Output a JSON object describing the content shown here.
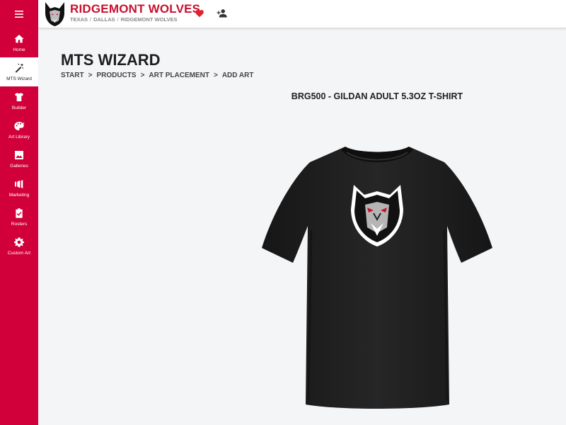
{
  "header": {
    "team_name": "RIDGEMONT WOLVES",
    "breadcrumb": [
      "TEXAS",
      "DALLAS",
      "RIDGEMONT WOLVES"
    ],
    "breadcrumb_separator": "/"
  },
  "sidebar": {
    "items": [
      {
        "label": "Home",
        "icon": "home-icon"
      },
      {
        "label": "MTS Wizard",
        "icon": "magic-wand-icon",
        "active": true
      },
      {
        "label": "Builder",
        "icon": "tshirt-icon"
      },
      {
        "label": "Art Library",
        "icon": "palette-icon"
      },
      {
        "label": "Galleries",
        "icon": "image-icon"
      },
      {
        "label": "Marketing",
        "icon": "megaphone-icon"
      },
      {
        "label": "Rosters",
        "icon": "clipboard-check-icon"
      },
      {
        "label": "Custom Art",
        "icon": "gear-icon"
      }
    ]
  },
  "main": {
    "title": "MTS WIZARD",
    "steps": [
      "START",
      "PRODUCTS",
      "ART PLACEMENT",
      "ADD ART"
    ],
    "step_separator": ">",
    "product_title": "BRG500 - GILDAN ADULT 5.3OZ T-SHIRT"
  },
  "colors": {
    "brand_red": "#d1003a",
    "title_red": "#c8102e",
    "shirt": "#1c1c1c"
  }
}
